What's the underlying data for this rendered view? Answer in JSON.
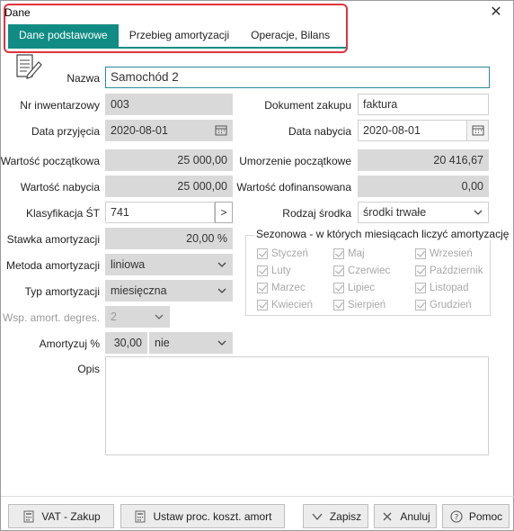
{
  "window": {
    "title": "Dane"
  },
  "tabs": [
    {
      "label": "Dane podstawowe",
      "active": true
    },
    {
      "label": "Przebieg amortyzacji",
      "active": false
    },
    {
      "label": "Operacje, Bilans",
      "active": false
    }
  ],
  "form": {
    "nazwa": {
      "label": "Nazwa",
      "value": "Samochód 2"
    },
    "nr_inwentarzowy": {
      "label": "Nr inwentarzowy",
      "value": "003"
    },
    "dokument_zakupu": {
      "label": "Dokument zakupu",
      "value": "faktura"
    },
    "data_przyjecia": {
      "label": "Data przyjęcia",
      "value": "2020-08-01"
    },
    "data_nabycia": {
      "label": "Data nabycia",
      "value": "2020-08-01"
    },
    "wartosc_poczatkowa": {
      "label": "Wartość początkowa",
      "value": "25 000,00"
    },
    "umorzenie_poczatkowe": {
      "label": "Umorzenie początkowe",
      "value": "20 416,67"
    },
    "wartosc_nabycia": {
      "label": "Wartość nabycia",
      "value": "25 000,00"
    },
    "wartosc_dofinansowana": {
      "label": "Wartość dofinansowana",
      "value": "0,00"
    },
    "klasyfikacja": {
      "label": "Klasyfikacja ŚT",
      "value": "741",
      "button": ">"
    },
    "rodzaj_srodka": {
      "label": "Rodzaj środka",
      "value": "środki trwałe"
    },
    "stawka_amortyzacji": {
      "label": "Stawka amortyzacji",
      "value": "20,00 %"
    },
    "metoda_amortyzacji": {
      "label": "Metoda amortyzacji",
      "value": "liniowa"
    },
    "typ_amortyzacji": {
      "label": "Typ amortyzacji",
      "value": "miesięczna"
    },
    "wsp_amort": {
      "label": "Wsp. amort. degres.",
      "value": "2"
    },
    "amortyzuj": {
      "label": "Amortyzuj %",
      "value": "30,00",
      "option": "nie"
    },
    "opis": {
      "label": "Opis",
      "value": ""
    }
  },
  "seasonal": {
    "title": "Sezonowa - w których miesiącach liczyć amortyzację",
    "months": [
      "Styczeń",
      "Maj",
      "Wrzesień",
      "Luty",
      "Czerwiec",
      "Październik",
      "Marzec",
      "Lipiec",
      "Listopad",
      "Kwiecień",
      "Sierpień",
      "Grudzień"
    ]
  },
  "buttons": {
    "vat": "VAT - Zakup",
    "ustaw": "Ustaw proc. koszt. amort",
    "zapisz": "Zapisz",
    "anuluj": "Anuluj",
    "pomoc": "Pomoc"
  },
  "colors": {
    "accent": "#108c84",
    "highlight": "#e0343c",
    "field_disabled": "#d9d9d9"
  }
}
